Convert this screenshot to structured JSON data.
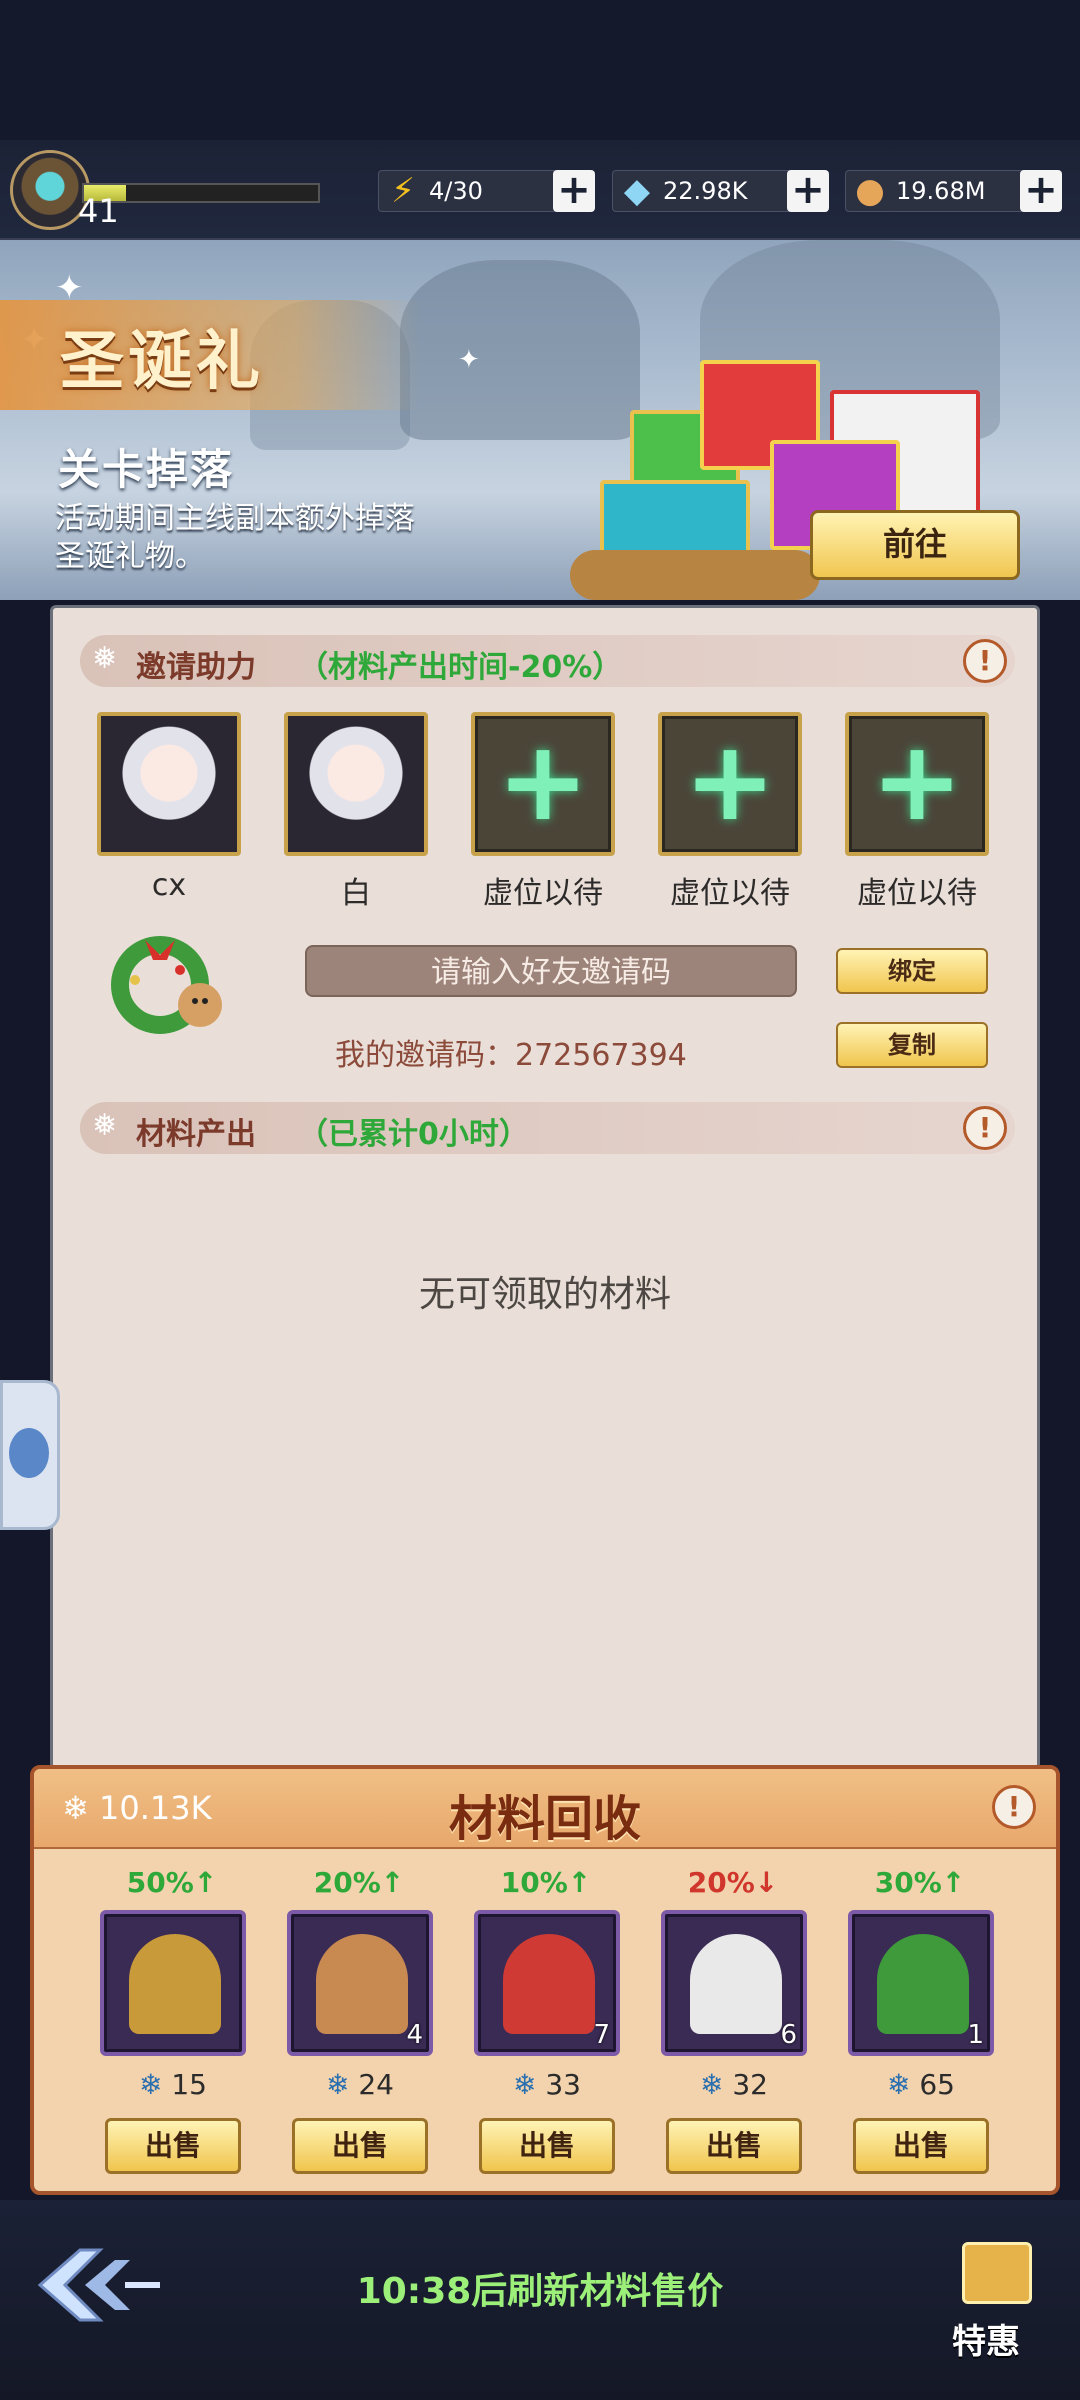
{
  "status": {
    "level": "41",
    "xp_fraction": 0.18,
    "energy": "4/30",
    "gems": "22.98K",
    "gold": "19.68M"
  },
  "banner": {
    "title": "圣诞礼",
    "subtitle": "关卡掉落",
    "description": "活动期间主线副本额外掉落圣诞礼物。",
    "goto_label": "前往"
  },
  "invite": {
    "header": "邀请助力",
    "note": "（材料产出时间-20%）",
    "slots": [
      {
        "name": "cx",
        "filled": true
      },
      {
        "name": "白",
        "filled": true
      },
      {
        "name": "虚位以待",
        "filled": false
      },
      {
        "name": "虚位以待",
        "filled": false
      },
      {
        "name": "虚位以待",
        "filled": false
      }
    ],
    "input_placeholder": "请输入好友邀请码",
    "bind_label": "绑定",
    "copy_label": "复制",
    "my_code": "我的邀请码：272567394"
  },
  "output": {
    "header": "材料产出",
    "note": "（已累计0小时）",
    "empty_message": "无可领取的材料"
  },
  "recycle": {
    "title": "材料回收",
    "currency": "10.13K",
    "items": [
      {
        "icon": "bell-icon",
        "trend": "50%↑",
        "trend_color": "#2fa83a",
        "count": "",
        "price": "15",
        "sell": "出售"
      },
      {
        "icon": "reindeer-icon",
        "trend": "20%↑",
        "trend_color": "#2fa83a",
        "count": "4",
        "price": "24",
        "sell": "出售"
      },
      {
        "icon": "stocking-icon",
        "trend": "10%↑",
        "trend_color": "#2fa83a",
        "count": "7",
        "price": "33",
        "sell": "出售"
      },
      {
        "icon": "candy-cane-icon",
        "trend": "20%↓",
        "trend_color": "#d0362c",
        "count": "6",
        "price": "32",
        "sell": "出售"
      },
      {
        "icon": "wreath-icon",
        "trend": "30%↑",
        "trend_color": "#2fa83a",
        "count": "1",
        "price": "65",
        "sell": "出售"
      }
    ]
  },
  "footer": {
    "refresh_text": "10:38后刷新材料售价",
    "special_label": "特惠"
  }
}
